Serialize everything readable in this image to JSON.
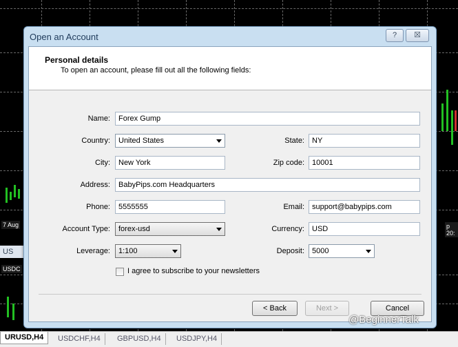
{
  "dialog": {
    "title": "Open an Account",
    "help_label": "?",
    "close_label": "☒",
    "header": {
      "title": "Personal details",
      "subtitle": "To open an account, please fill out all the following fields:"
    },
    "form": {
      "name_label": "Name:",
      "name_value": "Forex Gump",
      "country_label": "Country:",
      "country_value": "United States",
      "state_label": "State:",
      "state_value": "NY",
      "city_label": "City:",
      "city_value": "New York",
      "zip_label": "Zip code:",
      "zip_value": "10001",
      "address_label": "Address:",
      "address_value": "BabyPips.com Headquarters",
      "phone_label": "Phone:",
      "phone_value": "5555555",
      "email_label": "Email:",
      "email_value": "support@babypips.com",
      "account_type_label": "Account Type:",
      "account_type_value": "forex-usd",
      "currency_label": "Currency:",
      "currency_value": "USD",
      "leverage_label": "Leverage:",
      "leverage_value": "1:100",
      "deposit_label": "Deposit:",
      "deposit_value": "5000",
      "newsletter_label": "I agree to subscribe to your newsletters",
      "newsletter_checked": false
    },
    "buttons": {
      "back": "< Back",
      "next": "Next >",
      "cancel": "Cancel"
    }
  },
  "background": {
    "side_tags": [
      "7 Aug",
      "USDC",
      "p 20:"
    ],
    "side_tab_label": "US"
  },
  "tabs": [
    {
      "label": "URUSD,H4",
      "active": true
    },
    {
      "label": "USDCHF,H4",
      "active": false
    },
    {
      "label": "GBPUSD,H4",
      "active": false
    },
    {
      "label": "USDJPY,H4",
      "active": false
    }
  ],
  "watermark": "@BeginnerTalk"
}
